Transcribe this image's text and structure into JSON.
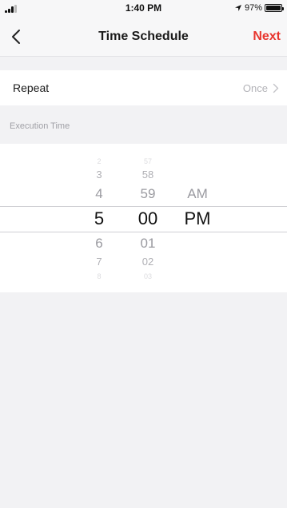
{
  "status_bar": {
    "time": "1:40 PM",
    "battery": "97%"
  },
  "nav": {
    "title": "Time Schedule",
    "next_label": "Next"
  },
  "repeat": {
    "label": "Repeat",
    "value": "Once"
  },
  "execution_label": "Execution Time",
  "picker": {
    "hours": [
      "2",
      "3",
      "4",
      "5",
      "6",
      "7",
      "8"
    ],
    "minutes": [
      "57",
      "58",
      "59",
      "00",
      "01",
      "02",
      "03"
    ],
    "period": [
      "AM",
      "PM"
    ]
  },
  "colors": {
    "accent": "#e8352e"
  }
}
